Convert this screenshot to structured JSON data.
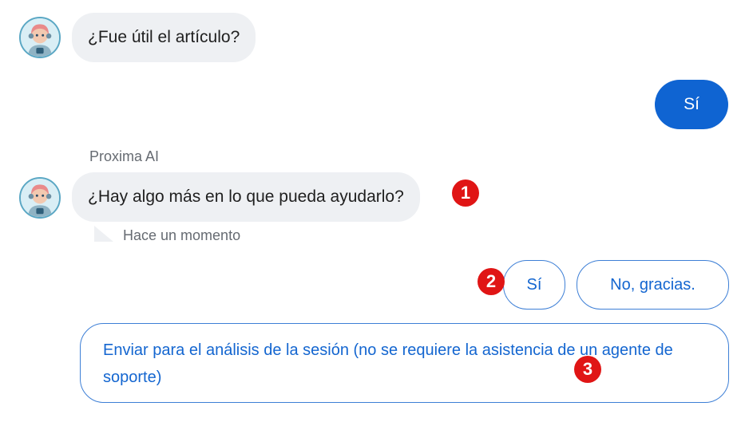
{
  "messages": {
    "bot_question_1": "¿Fue útil el artículo?",
    "user_reply": "Sí",
    "sender_name": "Proxima AI",
    "bot_question_2": "¿Hay algo más en lo que pueda ayudarlo?",
    "timestamp": "Hace un momento"
  },
  "quick_replies": {
    "yes": "Sí",
    "no": "No, gracias.",
    "send_analysis": "Enviar para el análisis de la sesión (no se requiere la asistencia de un agente de soporte)"
  },
  "markers": [
    "1",
    "2",
    "3"
  ],
  "avatar_icon": "robot-avatar-icon",
  "colors": {
    "accent": "#0f64d2",
    "bubble_bot": "#eef0f3",
    "quick_reply_border": "#3d7fd6",
    "quick_reply_text": "#1466d0",
    "marker": "#e01515"
  }
}
